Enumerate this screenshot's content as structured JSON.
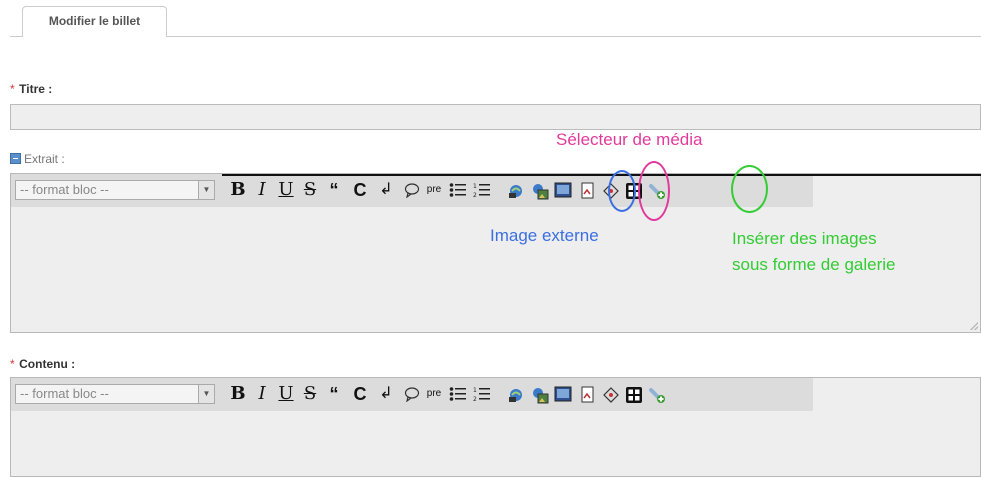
{
  "tab": {
    "label": "Modifier le billet"
  },
  "fields": {
    "title": {
      "required_mark": "*",
      "label": "Titre :",
      "value": ""
    },
    "excerpt": {
      "label": "Extrait :"
    },
    "content": {
      "required_mark": "*",
      "label": "Contenu :"
    }
  },
  "toolbar": {
    "format_select_value": "-- format bloc --",
    "bold": "B",
    "italic": "I",
    "underline": "U",
    "strike": "S",
    "quote": "“",
    "code": "C",
    "linebreak": "↲",
    "comment": "💬",
    "pre": "pre",
    "icons": [
      "bullet-list-icon",
      "numbered-list-icon",
      "link-icon",
      "external-image-icon",
      "media-selector-icon",
      "image-link-icon",
      "tag-link-icon",
      "gallery-icon",
      "attachment-icon"
    ]
  },
  "annotations": {
    "media_selector": "Sélecteur de média",
    "external_image": "Image externe",
    "gallery_line1": "Insérer des images",
    "gallery_line2": "sous forme de galerie"
  },
  "colors": {
    "media_selector": "#e23a9b",
    "external_image": "#3b6fe0",
    "gallery": "#33cc33",
    "required": "#dd3333"
  }
}
